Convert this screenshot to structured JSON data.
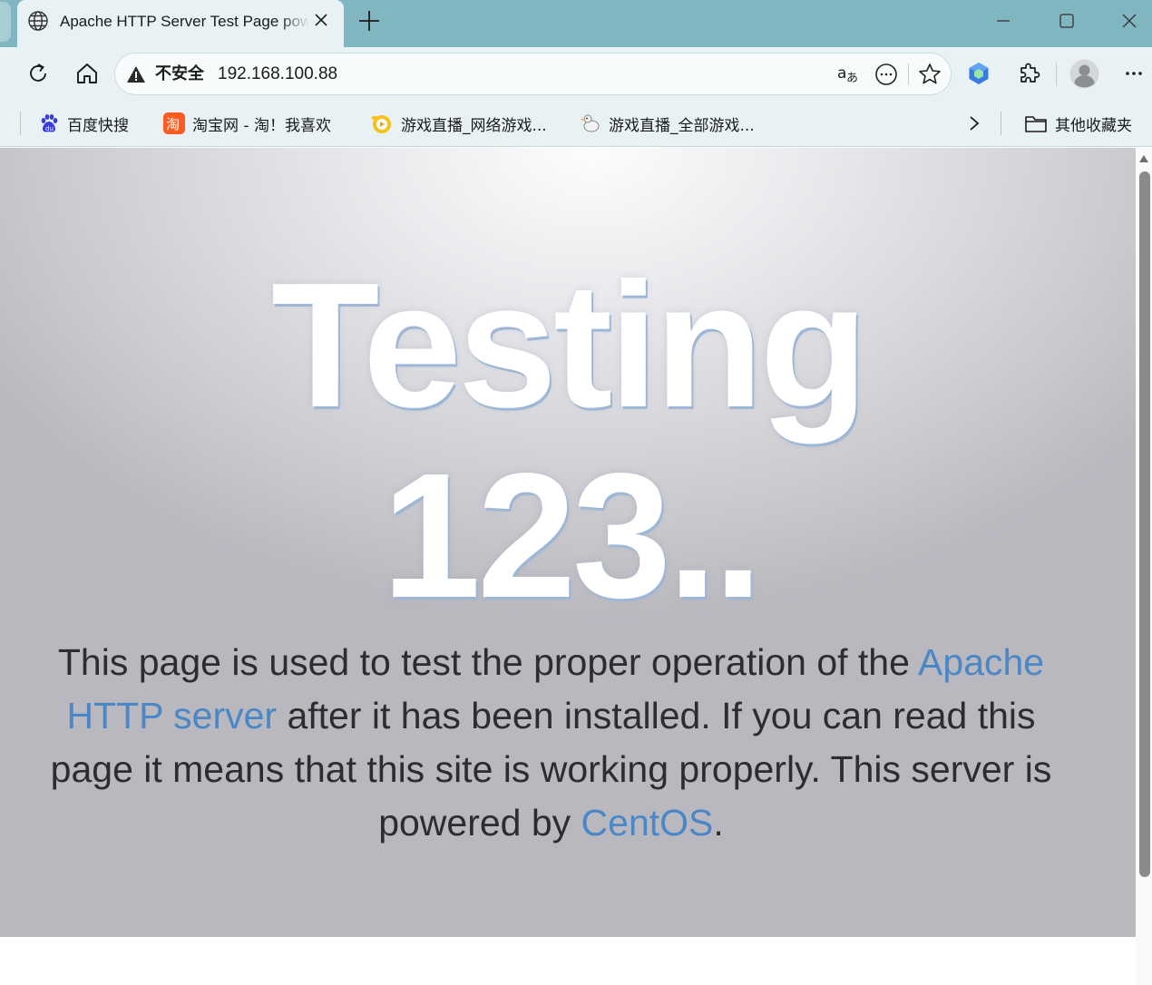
{
  "tab": {
    "title": "Apache HTTP Server Test Page powered by CentOS",
    "favicon": "globe-icon",
    "close_icon": "close-icon"
  },
  "new_tab_icon": "plus-icon",
  "window_controls": [
    "minimize-icon",
    "maximize-icon",
    "close-icon"
  ],
  "toolbar": {
    "refresh_icon": "refresh-icon",
    "home_icon": "home-icon",
    "security_label": "不安全",
    "url": "192.168.100.88",
    "omnibox_icons": [
      "read-aloud-translate-icon",
      "more-tools-icon",
      "favorite-star-icon"
    ],
    "extensions": [
      "hexagon-extension-icon",
      "puzzle-extensions-icon"
    ],
    "profile_icon": "avatar",
    "menu_icon": "ellipsis-icon"
  },
  "bookmarks": {
    "items": [
      {
        "label": "百度快搜",
        "icon": "baidu-paw-icon"
      },
      {
        "label": "淘宝网 - 淘！我喜欢",
        "icon": "taobao-icon"
      },
      {
        "label": "游戏直播_网络游戏...",
        "icon": "game-live-icon"
      },
      {
        "label": "游戏直播_全部游戏...",
        "icon": "goose-icon"
      }
    ],
    "overflow_icon": "chevron-right-icon",
    "other_folder": "其他收藏夹"
  },
  "page": {
    "hero_line1": "Testing",
    "hero_line2": "123..",
    "lead_part1": "This page is used to test the proper operation of the ",
    "lead_link1": "Apache HTTP server",
    "lead_part2": " after it has been installed. If you can read this page it means that this site is working properly. This server is powered by ",
    "lead_link2": "CentOS",
    "lead_part3": "."
  },
  "colors": {
    "tabstrip": "#80b6c0",
    "toolbar": "#e8f1f3",
    "link": "#4a87c6",
    "hero_shadow": "#9eb7d6"
  }
}
